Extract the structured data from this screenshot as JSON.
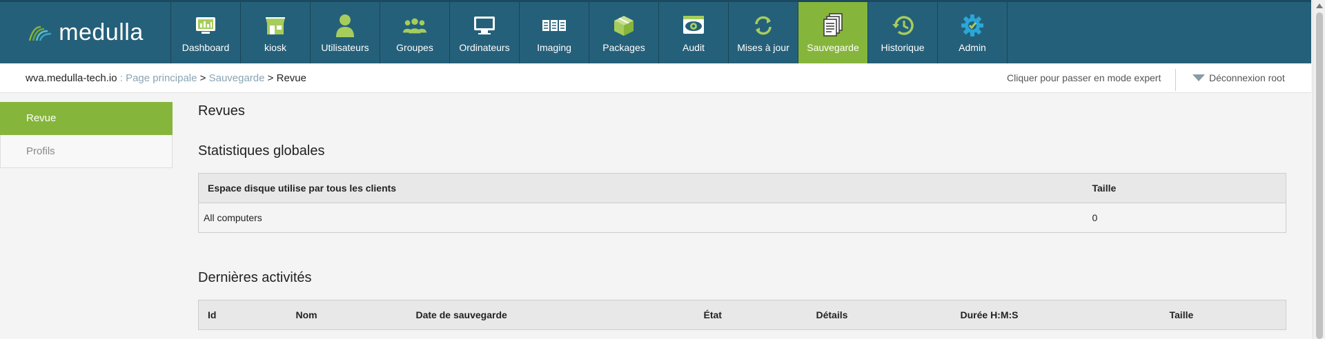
{
  "app": {
    "logo_text": "medulla"
  },
  "nav": [
    {
      "label": "Dashboard",
      "icon": "dashboard-icon",
      "active": false
    },
    {
      "label": "kiosk",
      "icon": "kiosk-icon",
      "active": false
    },
    {
      "label": "Utilisateurs",
      "icon": "user-icon",
      "active": false
    },
    {
      "label": "Groupes",
      "icon": "groups-icon",
      "active": false
    },
    {
      "label": "Ordinateurs",
      "icon": "computer-icon",
      "active": false
    },
    {
      "label": "Imaging",
      "icon": "imaging-icon",
      "active": false
    },
    {
      "label": "Packages",
      "icon": "packages-icon",
      "active": false
    },
    {
      "label": "Audit",
      "icon": "audit-icon",
      "active": false
    },
    {
      "label": "Mises à jour",
      "icon": "updates-icon",
      "active": false
    },
    {
      "label": "Sauvegarde",
      "icon": "backup-icon",
      "active": true
    },
    {
      "label": "Historique",
      "icon": "history-icon",
      "active": false
    },
    {
      "label": "Admin",
      "icon": "admin-gear-icon",
      "active": false
    }
  ],
  "breadcrumb": {
    "host": "wva.medulla-tech.io",
    "sep1": " : ",
    "home": "Page principale",
    "sep2": " > ",
    "section": "Sauvegarde",
    "sep3": " > ",
    "current": "Revue"
  },
  "header_actions": {
    "expert_mode": "Cliquer pour passer en mode expert",
    "logout": "Déconnexion root"
  },
  "sidebar": {
    "items": [
      {
        "label": "Revue",
        "active": true
      },
      {
        "label": "Profils",
        "active": false
      }
    ]
  },
  "main": {
    "title": "Revues",
    "stats": {
      "heading": "Statistiques globales",
      "columns": [
        "Espace disque utilise par tous les clients",
        "Taille"
      ],
      "rows": [
        [
          "All computers",
          "0"
        ]
      ]
    },
    "activities": {
      "heading": "Dernières activités",
      "columns": [
        "Id",
        "Nom",
        "Date de sauvegarde",
        "État",
        "Détails",
        "Durée H:M:S",
        "Taille"
      ]
    }
  },
  "colors": {
    "nav_bg": "#25607a",
    "accent": "#86b53c",
    "icon_green": "#a6cd5c",
    "icon_blue": "#2aa6d8"
  }
}
